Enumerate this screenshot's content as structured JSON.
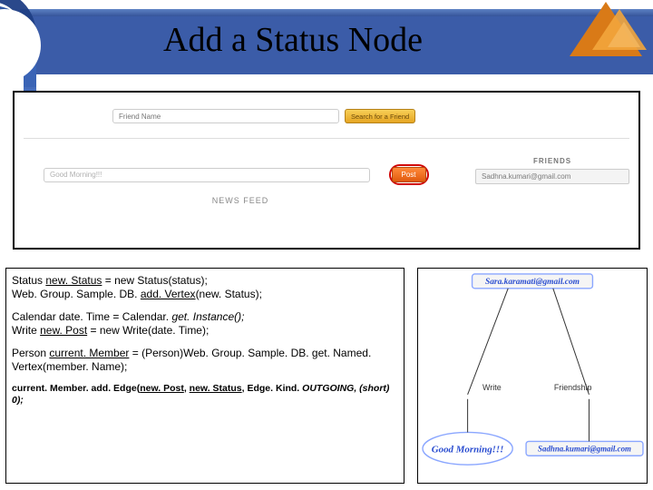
{
  "header": {
    "title": "Add a Status Node"
  },
  "ui": {
    "search_placeholder": "Friend Name",
    "search_button": "Search for a Friend",
    "status_value": "Good Morning!!!",
    "post_button": "Post",
    "newsfeed_label": "NEWS FEED",
    "friends_label": "FRIENDS",
    "friend_entry": "Sadhna.kumari@gmail.com"
  },
  "code": {
    "l1a": "Status ",
    "l1b": "new. Status",
    "l1c": " = new Status(status);",
    "l2a": "Web. Group. Sample. DB. ",
    "l2b": "add. Vertex",
    "l2c": "(new. Status);",
    "l3a": "Calendar date. Time = Calendar. ",
    "l3b": "get. Instance();",
    "l4a": "Write ",
    "l4b": "new. Post",
    "l4c": " = new Write(date. Time);",
    "l5a": "Person ",
    "l5b": "current. Member",
    "l5c": " = (Person)Web. Group. Sample. DB. get. Named. Vertex(member. Name);",
    "l6a": "current. Member. add. Edge(",
    "l6b": "new. Post",
    "l6c": ", ",
    "l6d": "new. Status",
    "l6e": ", Edge. Kind. ",
    "l6f": "OUTGOING",
    "l6g": ", (short) 0);"
  },
  "diagram": {
    "top_email": "Sara.karamati@gmail.com",
    "edge1": "Write",
    "edge2": "Friendship",
    "bubble": "Good Morning!!!",
    "bottom_email": "Sadhna.kumari@gmail.com"
  }
}
